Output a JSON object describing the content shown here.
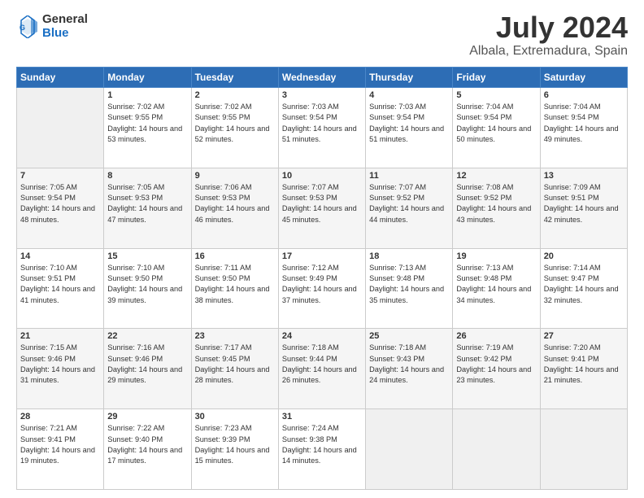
{
  "header": {
    "logo_line1": "General",
    "logo_line2": "Blue",
    "title": "July 2024",
    "location": "Albala, Extremadura, Spain"
  },
  "weekdays": [
    "Sunday",
    "Monday",
    "Tuesday",
    "Wednesday",
    "Thursday",
    "Friday",
    "Saturday"
  ],
  "weeks": [
    [
      {
        "day": "",
        "empty": true
      },
      {
        "day": "1",
        "sunrise": "Sunrise: 7:02 AM",
        "sunset": "Sunset: 9:55 PM",
        "daylight": "Daylight: 14 hours and 53 minutes."
      },
      {
        "day": "2",
        "sunrise": "Sunrise: 7:02 AM",
        "sunset": "Sunset: 9:55 PM",
        "daylight": "Daylight: 14 hours and 52 minutes."
      },
      {
        "day": "3",
        "sunrise": "Sunrise: 7:03 AM",
        "sunset": "Sunset: 9:54 PM",
        "daylight": "Daylight: 14 hours and 51 minutes."
      },
      {
        "day": "4",
        "sunrise": "Sunrise: 7:03 AM",
        "sunset": "Sunset: 9:54 PM",
        "daylight": "Daylight: 14 hours and 51 minutes."
      },
      {
        "day": "5",
        "sunrise": "Sunrise: 7:04 AM",
        "sunset": "Sunset: 9:54 PM",
        "daylight": "Daylight: 14 hours and 50 minutes."
      },
      {
        "day": "6",
        "sunrise": "Sunrise: 7:04 AM",
        "sunset": "Sunset: 9:54 PM",
        "daylight": "Daylight: 14 hours and 49 minutes."
      }
    ],
    [
      {
        "day": "7",
        "sunrise": "Sunrise: 7:05 AM",
        "sunset": "Sunset: 9:54 PM",
        "daylight": "Daylight: 14 hours and 48 minutes."
      },
      {
        "day": "8",
        "sunrise": "Sunrise: 7:05 AM",
        "sunset": "Sunset: 9:53 PM",
        "daylight": "Daylight: 14 hours and 47 minutes."
      },
      {
        "day": "9",
        "sunrise": "Sunrise: 7:06 AM",
        "sunset": "Sunset: 9:53 PM",
        "daylight": "Daylight: 14 hours and 46 minutes."
      },
      {
        "day": "10",
        "sunrise": "Sunrise: 7:07 AM",
        "sunset": "Sunset: 9:53 PM",
        "daylight": "Daylight: 14 hours and 45 minutes."
      },
      {
        "day": "11",
        "sunrise": "Sunrise: 7:07 AM",
        "sunset": "Sunset: 9:52 PM",
        "daylight": "Daylight: 14 hours and 44 minutes."
      },
      {
        "day": "12",
        "sunrise": "Sunrise: 7:08 AM",
        "sunset": "Sunset: 9:52 PM",
        "daylight": "Daylight: 14 hours and 43 minutes."
      },
      {
        "day": "13",
        "sunrise": "Sunrise: 7:09 AM",
        "sunset": "Sunset: 9:51 PM",
        "daylight": "Daylight: 14 hours and 42 minutes."
      }
    ],
    [
      {
        "day": "14",
        "sunrise": "Sunrise: 7:10 AM",
        "sunset": "Sunset: 9:51 PM",
        "daylight": "Daylight: 14 hours and 41 minutes."
      },
      {
        "day": "15",
        "sunrise": "Sunrise: 7:10 AM",
        "sunset": "Sunset: 9:50 PM",
        "daylight": "Daylight: 14 hours and 39 minutes."
      },
      {
        "day": "16",
        "sunrise": "Sunrise: 7:11 AM",
        "sunset": "Sunset: 9:50 PM",
        "daylight": "Daylight: 14 hours and 38 minutes."
      },
      {
        "day": "17",
        "sunrise": "Sunrise: 7:12 AM",
        "sunset": "Sunset: 9:49 PM",
        "daylight": "Daylight: 14 hours and 37 minutes."
      },
      {
        "day": "18",
        "sunrise": "Sunrise: 7:13 AM",
        "sunset": "Sunset: 9:48 PM",
        "daylight": "Daylight: 14 hours and 35 minutes."
      },
      {
        "day": "19",
        "sunrise": "Sunrise: 7:13 AM",
        "sunset": "Sunset: 9:48 PM",
        "daylight": "Daylight: 14 hours and 34 minutes."
      },
      {
        "day": "20",
        "sunrise": "Sunrise: 7:14 AM",
        "sunset": "Sunset: 9:47 PM",
        "daylight": "Daylight: 14 hours and 32 minutes."
      }
    ],
    [
      {
        "day": "21",
        "sunrise": "Sunrise: 7:15 AM",
        "sunset": "Sunset: 9:46 PM",
        "daylight": "Daylight: 14 hours and 31 minutes."
      },
      {
        "day": "22",
        "sunrise": "Sunrise: 7:16 AM",
        "sunset": "Sunset: 9:46 PM",
        "daylight": "Daylight: 14 hours and 29 minutes."
      },
      {
        "day": "23",
        "sunrise": "Sunrise: 7:17 AM",
        "sunset": "Sunset: 9:45 PM",
        "daylight": "Daylight: 14 hours and 28 minutes."
      },
      {
        "day": "24",
        "sunrise": "Sunrise: 7:18 AM",
        "sunset": "Sunset: 9:44 PM",
        "daylight": "Daylight: 14 hours and 26 minutes."
      },
      {
        "day": "25",
        "sunrise": "Sunrise: 7:18 AM",
        "sunset": "Sunset: 9:43 PM",
        "daylight": "Daylight: 14 hours and 24 minutes."
      },
      {
        "day": "26",
        "sunrise": "Sunrise: 7:19 AM",
        "sunset": "Sunset: 9:42 PM",
        "daylight": "Daylight: 14 hours and 23 minutes."
      },
      {
        "day": "27",
        "sunrise": "Sunrise: 7:20 AM",
        "sunset": "Sunset: 9:41 PM",
        "daylight": "Daylight: 14 hours and 21 minutes."
      }
    ],
    [
      {
        "day": "28",
        "sunrise": "Sunrise: 7:21 AM",
        "sunset": "Sunset: 9:41 PM",
        "daylight": "Daylight: 14 hours and 19 minutes."
      },
      {
        "day": "29",
        "sunrise": "Sunrise: 7:22 AM",
        "sunset": "Sunset: 9:40 PM",
        "daylight": "Daylight: 14 hours and 17 minutes."
      },
      {
        "day": "30",
        "sunrise": "Sunrise: 7:23 AM",
        "sunset": "Sunset: 9:39 PM",
        "daylight": "Daylight: 14 hours and 15 minutes."
      },
      {
        "day": "31",
        "sunrise": "Sunrise: 7:24 AM",
        "sunset": "Sunset: 9:38 PM",
        "daylight": "Daylight: 14 hours and 14 minutes."
      },
      {
        "day": "",
        "empty": true
      },
      {
        "day": "",
        "empty": true
      },
      {
        "day": "",
        "empty": true
      }
    ]
  ]
}
